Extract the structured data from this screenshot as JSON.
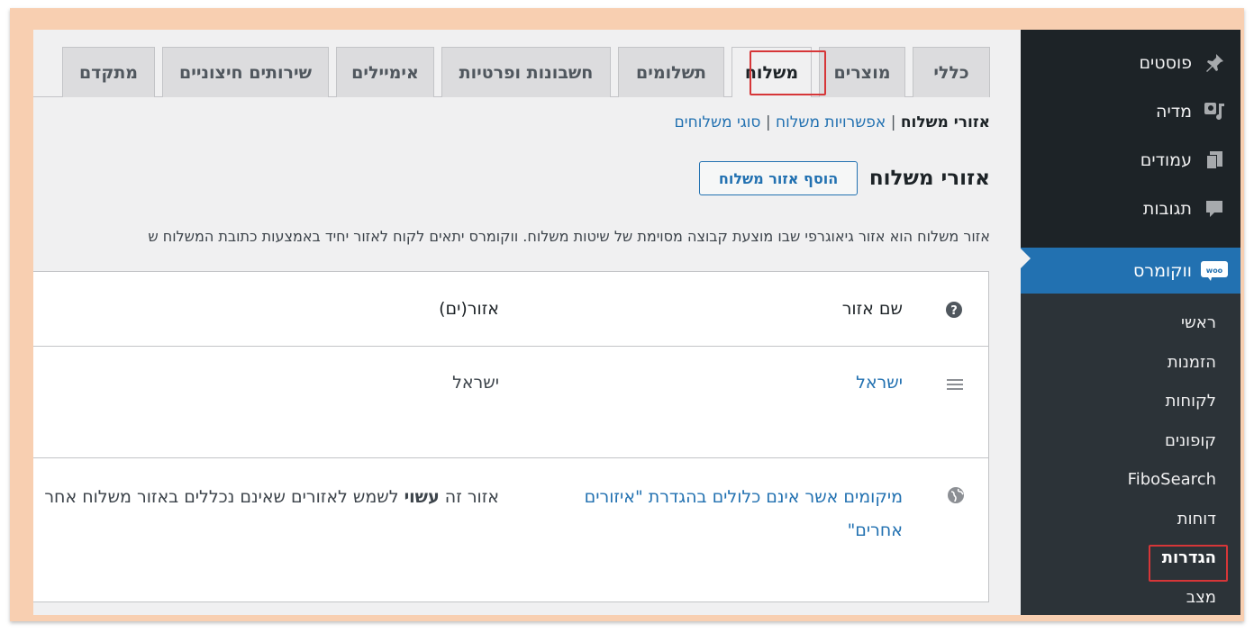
{
  "sidebar": {
    "items": [
      {
        "label": "פוסטים",
        "icon": "pin-icon"
      },
      {
        "label": "מדיה",
        "icon": "media-icon"
      },
      {
        "label": "עמודים",
        "icon": "pages-icon"
      },
      {
        "label": "תגובות",
        "icon": "comments-icon"
      }
    ],
    "current": {
      "label": "ווקומרס",
      "icon": "woo-icon"
    },
    "submenu": [
      "ראשי",
      "הזמנות",
      "לקוחות",
      "קופונים",
      "FiboSearch",
      "דוחות",
      "הגדרות",
      "מצב"
    ]
  },
  "tabs": [
    "כללי",
    "מוצרים",
    "משלוח",
    "תשלומים",
    "חשבונות ופרטיות",
    "אימיילים",
    "שירותים חיצוניים",
    "מתקדם"
  ],
  "subsubsub": {
    "current": "אזורי משלוח",
    "sep": "|",
    "options": "אפשרויות משלוח",
    "classes": "סוגי משלוחים"
  },
  "page": {
    "title": "אזורי משלוח",
    "add_button": "הוסף אזור משלוח",
    "description": "אזור משלוח הוא אזור גיאוגרפי שבו מוצעת קבוצה מסוימת של שיטות משלוח. ווקומרס יתאים לקוח לאזור יחיד באמצעות כתובת המשלוח ש"
  },
  "table": {
    "headers": {
      "name": "שם אזור",
      "regions": "אזור(ים)"
    },
    "rows": [
      {
        "name": "ישראל",
        "regions": "ישראל"
      }
    ],
    "other": {
      "name_line1": "מיקומים אשר אינם כלולים בהגדרת \"איזורים",
      "name_line2": "אחרים\"",
      "desc_prefix": "אזור זה ",
      "desc_bold": "עשוי",
      "desc_suffix": " לשמש לאזורים שאינם נכללים באזור משלוח אחר"
    }
  },
  "colors": {
    "accent": "#2271b1",
    "sidebar": "#1d2327",
    "highlight": "#d63638"
  }
}
